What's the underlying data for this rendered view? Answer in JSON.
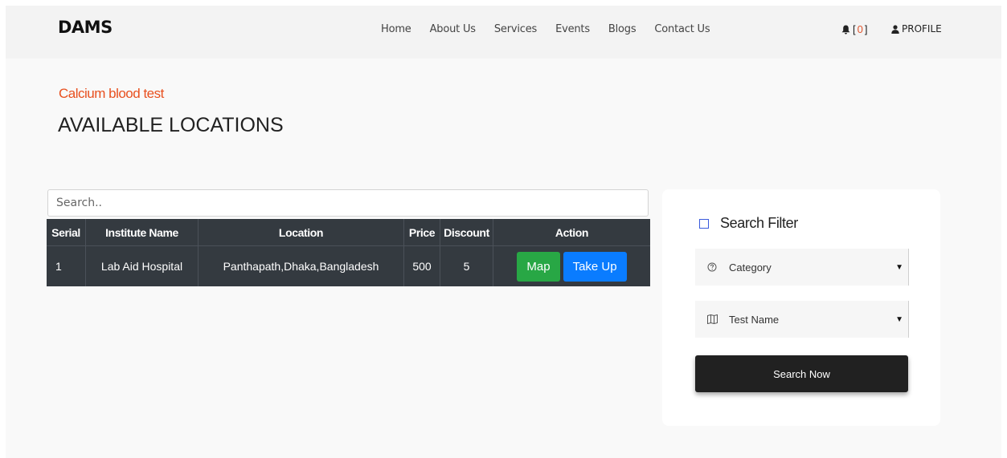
{
  "header": {
    "brand": "DAMS",
    "nav": [
      "Home",
      "About Us",
      "Services",
      "Events",
      "Blogs",
      "Contact Us"
    ],
    "notifications": {
      "open": "[",
      "count": "0",
      "close": "]"
    },
    "profile_label": "PROFILE",
    "accent_color": "#e0532b"
  },
  "page": {
    "subtitle": "Calcium blood test",
    "title": "AVAILABLE LOCATIONS"
  },
  "search": {
    "placeholder": "Search.."
  },
  "table": {
    "headers": [
      "Serial",
      "Institute Name",
      "Location",
      "Price",
      "Discount",
      "Action"
    ],
    "rows": [
      {
        "serial": "1",
        "institute": "Lab Aid Hospital",
        "location": "Panthapath,Dhaka,Bangladesh",
        "price": "500",
        "discount": "5",
        "map_label": "Map",
        "take_label": "Take Up"
      }
    ],
    "header_bg": "#343a40"
  },
  "filter": {
    "title": "Search Filter",
    "category_label": "Category",
    "test_name_label": "Test Name",
    "button_label": "Search Now"
  },
  "icons": {
    "bell": "bell-icon",
    "user": "user-icon",
    "question": "question-circle-icon",
    "map": "map-icon",
    "caret": "caret-down-icon"
  }
}
